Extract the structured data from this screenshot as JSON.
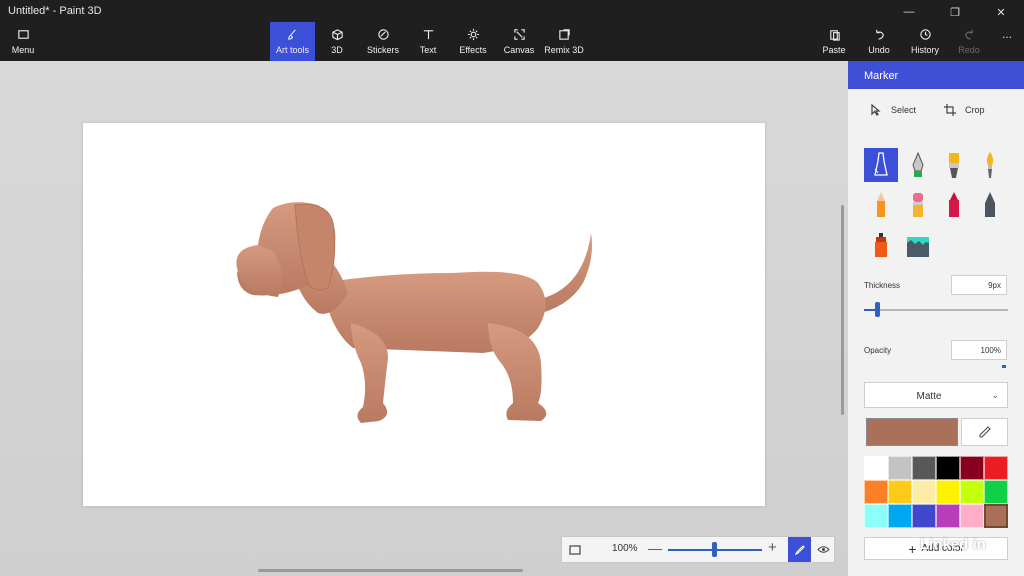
{
  "window": {
    "title": "Untitled* - Paint 3D"
  },
  "toolbar": {
    "menu": "Menu",
    "tabs": [
      {
        "label": "Art tools",
        "icon": "brush-icon"
      },
      {
        "label": "3D",
        "icon": "cube-icon"
      },
      {
        "label": "Stickers",
        "icon": "sticker-icon"
      },
      {
        "label": "Text",
        "icon": "text-icon"
      },
      {
        "label": "Effects",
        "icon": "sun-icon"
      },
      {
        "label": "Canvas",
        "icon": "canvas-icon"
      },
      {
        "label": "Remix 3D",
        "icon": "remix-icon"
      }
    ],
    "actions": [
      {
        "label": "Paste",
        "icon": "paste-icon"
      },
      {
        "label": "Undo",
        "icon": "undo-icon"
      },
      {
        "label": "History",
        "icon": "history-icon"
      },
      {
        "label": "Redo",
        "icon": "redo-icon"
      }
    ],
    "more": "..."
  },
  "panel": {
    "title": "Marker",
    "select": "Select",
    "crop": "Crop",
    "tools": [
      "marker",
      "calligraphy-pen",
      "oil-brush",
      "watercolor",
      "pencil",
      "eraser",
      "crayon",
      "pixel-pen",
      "spray-can",
      "fill-bucket"
    ],
    "thickness_label": "Thickness",
    "thickness_value": "9px",
    "thickness_level": 0.07,
    "opacity_label": "Opacity",
    "opacity_value": "100%",
    "opacity_level": 1.0,
    "finish": "Matte",
    "current_color": "#a9715a",
    "palette": [
      "#ffffff",
      "#c3c3c3",
      "#585858",
      "#000000",
      "#88001b",
      "#ec1c24",
      "#ff7f27",
      "#ffca18",
      "#fdeca6",
      "#fff200",
      "#c4ff0e",
      "#0ed145",
      "#8cfffb",
      "#00a8f3",
      "#3f48cc",
      "#b83dba",
      "#ffaec8",
      "#a9715a"
    ],
    "add_color": "Add color"
  },
  "zoom": {
    "value": "100%",
    "minus": "—",
    "plus": "+"
  },
  "watermark": "Linked in",
  "colors": {
    "accent": "#3b4fd9",
    "dog": "#c98a70"
  }
}
